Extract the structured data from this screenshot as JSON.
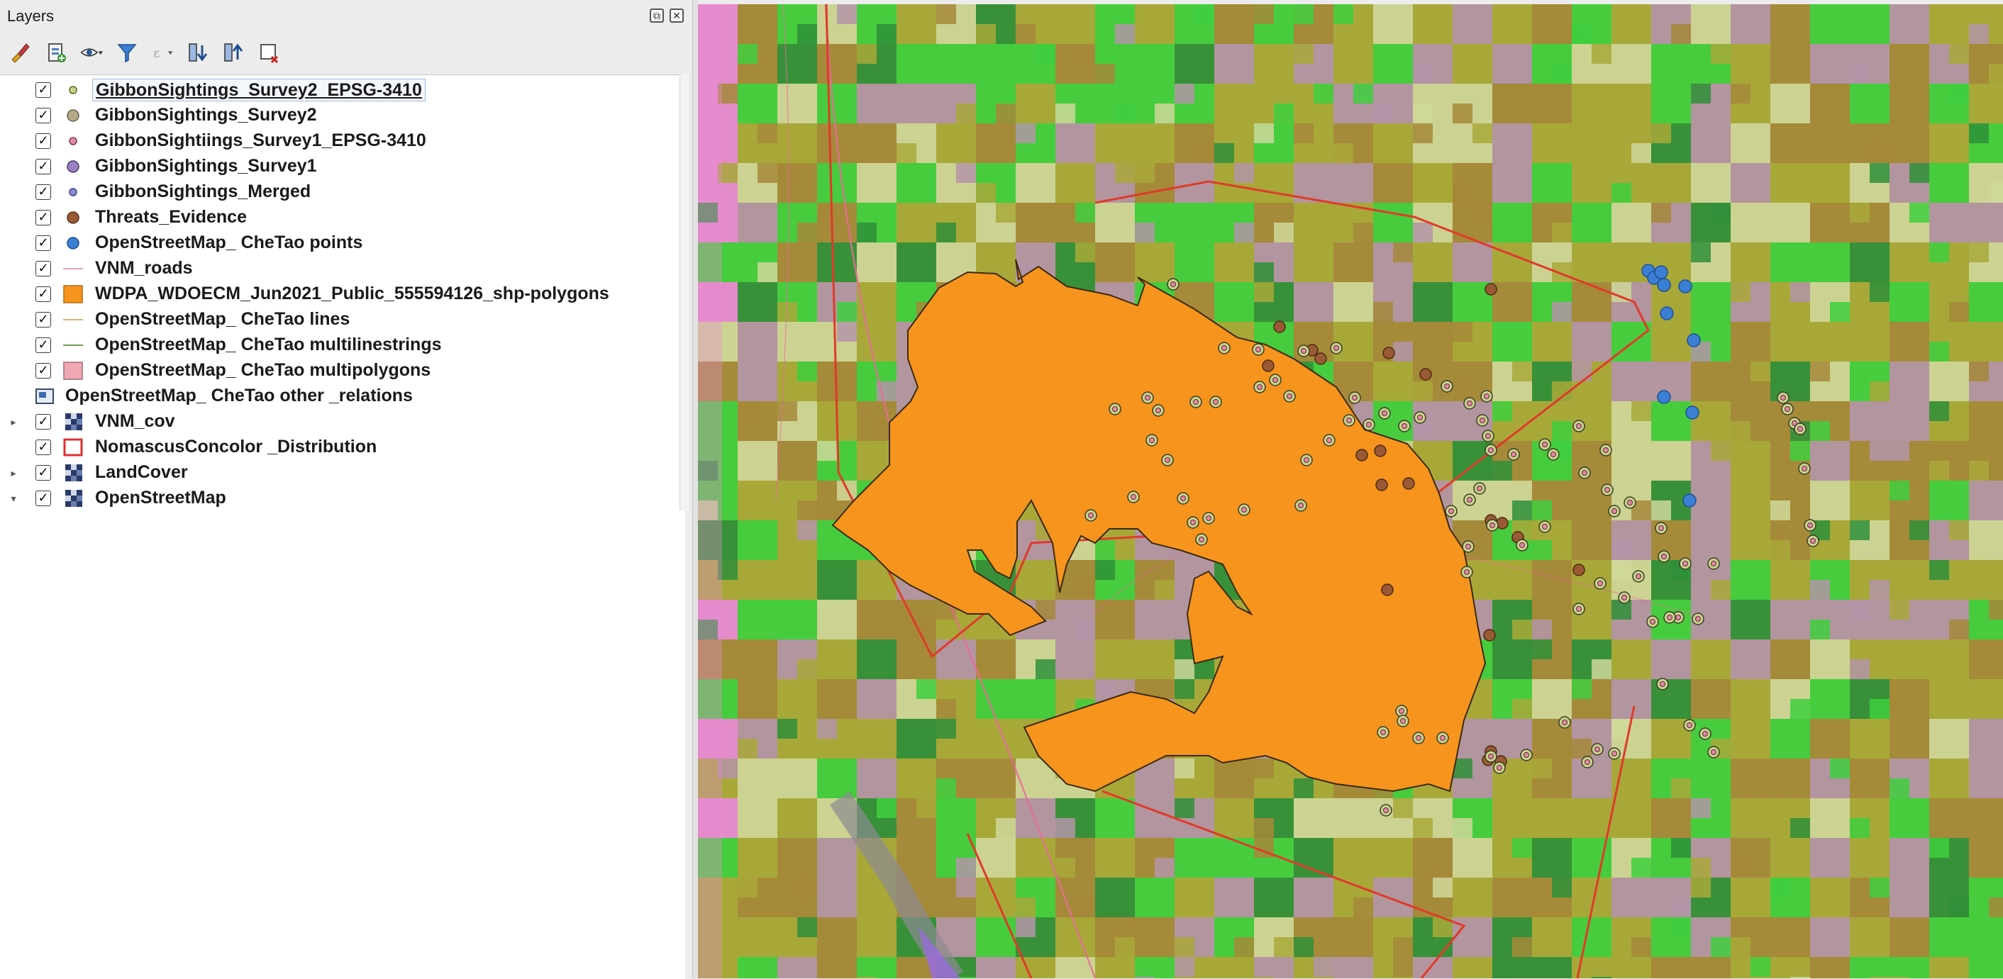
{
  "panel": {
    "title": "Layers",
    "float_button": "⧉",
    "close_button": "✕"
  },
  "toolbar": {
    "buttons": [
      {
        "name": "style-manager-icon"
      },
      {
        "name": "add-group-icon"
      },
      {
        "name": "visibility-eye-icon"
      },
      {
        "name": "filter-icon"
      },
      {
        "name": "filter-expression-icon"
      },
      {
        "name": "expand-all-icon"
      },
      {
        "name": "collapse-all-icon"
      },
      {
        "name": "remove-layer-icon"
      }
    ]
  },
  "layers": [
    {
      "label": "GibbonSightings_Survey2_EPSG-3410",
      "checked": true,
      "symbol": "point",
      "color": "#c9d48a",
      "stroke": "#5a6b1a",
      "size": "small",
      "selected": true
    },
    {
      "label": "GibbonSightings_Survey2",
      "checked": true,
      "symbol": "point",
      "color": "#b5a88a",
      "stroke": "#6a5f4a",
      "size": "large"
    },
    {
      "label": "GibbonSightiings_Survey1_EPSG-3410",
      "checked": true,
      "symbol": "point",
      "color": "#e48aa6",
      "stroke": "#7a3a52",
      "size": "small"
    },
    {
      "label": "GibbonSightings_Survey1",
      "checked": true,
      "symbol": "point",
      "color": "#9a7fc2",
      "stroke": "#4a3a70",
      "size": "large"
    },
    {
      "label": "GibbonSightings_Merged",
      "checked": true,
      "symbol": "point",
      "color": "#8a8fd0",
      "stroke": "#3a3f80",
      "size": "small"
    },
    {
      "label": "Threats_Evidence",
      "checked": true,
      "symbol": "point",
      "color": "#9a5a35",
      "stroke": "#5a2f15",
      "size": "large"
    },
    {
      "label": "OpenStreetMap_ CheTao points",
      "checked": true,
      "symbol": "point",
      "color": "#3b7fd4",
      "stroke": "#1f4f8f",
      "size": "large"
    },
    {
      "label": "VNM_roads",
      "checked": true,
      "symbol": "line",
      "color": "#e8a0b4"
    },
    {
      "label": "WDPA_WDOECM_Jun2021_Public_555594126_shp-polygons",
      "checked": true,
      "symbol": "fill",
      "color": "#f7941d",
      "stroke": "#b56a10"
    },
    {
      "label": "OpenStreetMap_ CheTao lines",
      "checked": true,
      "symbol": "line",
      "color": "#d9b36a"
    },
    {
      "label": "OpenStreetMap_ CheTao multilinestrings",
      "checked": true,
      "symbol": "line",
      "color": "#6a9a5a"
    },
    {
      "label": "OpenStreetMap_ CheTao multipolygons",
      "checked": true,
      "symbol": "fill",
      "color": "#f0a8b4",
      "stroke": "#a36a74"
    },
    {
      "label": "OpenStreetMap_ CheTao other _relations",
      "checked": null,
      "symbol": "table"
    },
    {
      "label": "VNM_cov",
      "checked": true,
      "symbol": "raster",
      "expander": "▸"
    },
    {
      "label": "NomascusConcolor _Distribution",
      "checked": true,
      "symbol": "outline",
      "color": "#e03030"
    },
    {
      "label": "LandCover",
      "checked": true,
      "symbol": "raster",
      "expander": "▸"
    },
    {
      "label": "OpenStreetMap",
      "checked": true,
      "symbol": "raster",
      "expander": "▾"
    }
  ],
  "map": {
    "colors": {
      "base": "#a8a83a",
      "green": "#3ecf3e",
      "dark_green": "#2f8f3a",
      "mauve": "#b494a8",
      "brown": "#a5883a",
      "light": "#cfd79a",
      "pink": "#e98ad6",
      "protected_area": "#f7941d",
      "distribution_outline": "#e03a2a",
      "road": "#e86a9a",
      "osm_point": "#3b7fd4",
      "threat": "#9a5a35",
      "sighting_ring": "#e48aa6"
    }
  }
}
